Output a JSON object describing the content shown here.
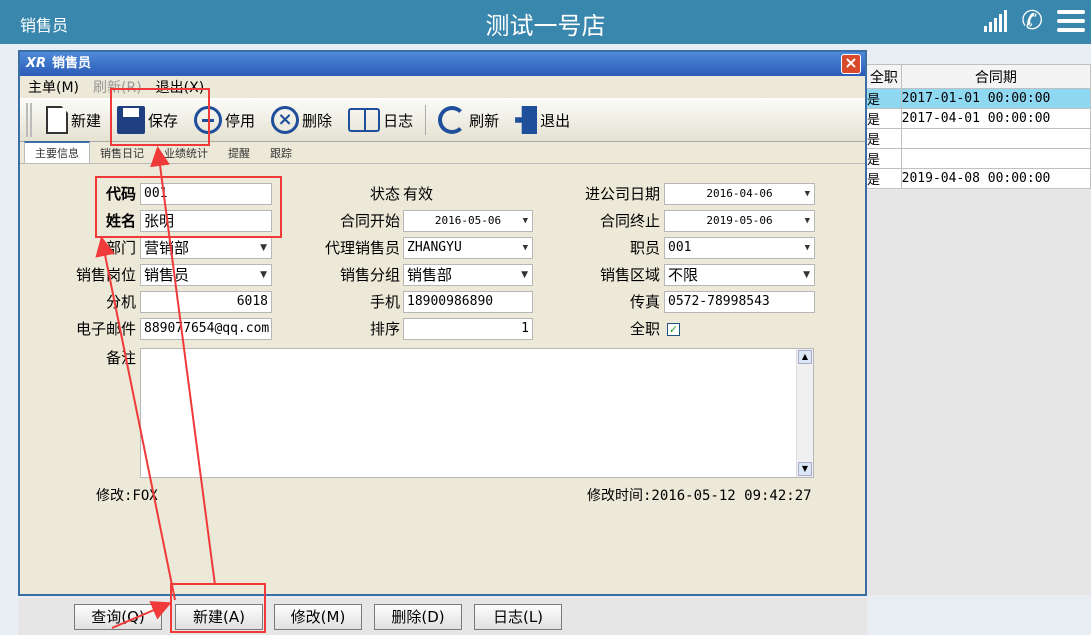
{
  "app": {
    "title": "销售员",
    "store_name": "测试一号店"
  },
  "bg_table": {
    "headers": [
      "全职",
      "合同期"
    ],
    "rows": [
      [
        "是",
        "2017-01-01 00:00:00"
      ],
      [
        "是",
        "2017-04-01 00:00:00"
      ],
      [
        "是",
        ""
      ],
      [
        "是",
        ""
      ],
      [
        "是",
        "2019-04-08 00:00:00"
      ]
    ]
  },
  "dialog": {
    "logo": "XR",
    "title": "销售员",
    "close": "×",
    "menu": [
      {
        "label": "主单(M)",
        "enabled": true
      },
      {
        "label": "刷新(R)",
        "enabled": false
      },
      {
        "label": "退出(X)",
        "enabled": true
      }
    ],
    "toolbar": {
      "new": "新建",
      "save": "保存",
      "disable": "停用",
      "delete": "删除",
      "log": "日志",
      "refresh": "刷新",
      "exit": "退出"
    },
    "tabs": [
      "主要信息",
      "销售日记",
      "业绩统计",
      "提醒",
      "跟踪"
    ],
    "form": {
      "code_label": "代码",
      "code": "001",
      "name_label": "姓名",
      "name": "张明",
      "dept_label": "部门",
      "dept": "营销部",
      "position_label": "销售岗位",
      "position": "销售员",
      "ext_label": "分机",
      "ext": "6018",
      "email_label": "电子邮件",
      "email": "889077654@qq.com",
      "status_label": "状态",
      "status": "有效",
      "contract_start_label": "合同开始",
      "contract_start": "2016-05-06",
      "agent_label": "代理销售员",
      "agent": "ZHANGYU",
      "group_label": "销售分组",
      "group": "销售部",
      "mobile_label": "手机",
      "mobile": "18900986890",
      "order_label": "排序",
      "order": "1",
      "join_date_label": "进公司日期",
      "join_date": "2016-04-06",
      "contract_end_label": "合同终止",
      "contract_end": "2019-05-06",
      "employee_label": "职员",
      "employee": "001",
      "region_label": "销售区域",
      "region": "不限",
      "fax_label": "传真",
      "fax": "0572-78998543",
      "fulltime_label": "全职",
      "fulltime_checked": "✓",
      "memo_label": "备注",
      "modified_by": "修改:FOX",
      "modified_time": "修改时间:2016-05-12 09:42:27"
    }
  },
  "bottom_buttons": {
    "query": "查询(Q)",
    "new": "新建(A)",
    "edit": "修改(M)",
    "delete": "删除(D)",
    "log": "日志(L)"
  },
  "colors": {
    "annotation": "#f03a3a",
    "title_bar": "#3a87ad",
    "selected_row": "#8fd8f2"
  }
}
